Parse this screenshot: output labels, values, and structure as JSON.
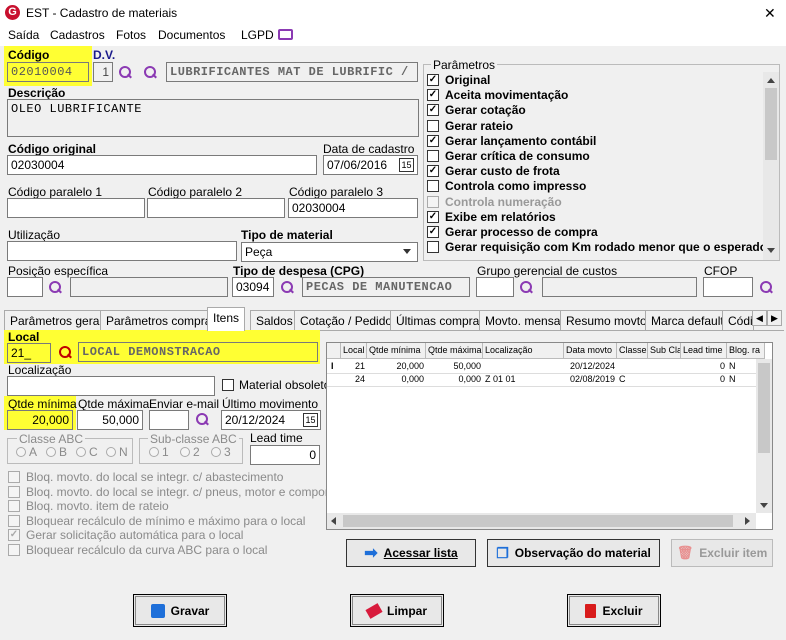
{
  "window": {
    "title": "EST - Cadastro de materiais",
    "close": "✕"
  },
  "menu": [
    "Saída",
    "Cadastros",
    "Fotos",
    "Documentos",
    "LGPD"
  ],
  "header": {
    "codigo_label": "Código",
    "codigo_value": "02010004",
    "dv_label": "D.V.",
    "dv_value": "1",
    "descricao_grupo": "LUBRIFICANTES MAT DE LUBRIFIC / LUBI",
    "descricao_label": "Descrição",
    "descricao_value": "OLEO LUBRIFICANTE",
    "codigo_original_label": "Código original",
    "codigo_original_value": "02030004",
    "data_cadastro_label": "Data de cadastro",
    "data_cadastro_value": "07/06/2016",
    "calendar_label": "15",
    "cod_par1_label": "Código paralelo 1",
    "cod_par2_label": "Código paralelo 2",
    "cod_par3_label": "Código paralelo 3",
    "cod_par3_value": "02030004",
    "utilizacao_label": "Utilização",
    "tipo_material_label": "Tipo de material",
    "tipo_material_value": "Peça",
    "posicao_label": "Posição específica",
    "tipo_despesa_label": "Tipo de despesa (CPG)",
    "tipo_despesa_code": "03094",
    "tipo_despesa_desc": "PECAS DE MANUTENCAO",
    "grupo_gerencial_label": "Grupo gerencial de custos",
    "cfop_label": "CFOP"
  },
  "parametros": {
    "title": "Parâmetros",
    "items": [
      {
        "label": "Original",
        "checked": true,
        "enabled": true
      },
      {
        "label": "Aceita movimentação",
        "checked": true,
        "enabled": true
      },
      {
        "label": "Gerar cotação",
        "checked": true,
        "enabled": true
      },
      {
        "label": "Gerar rateio",
        "checked": false,
        "enabled": true
      },
      {
        "label": "Gerar lançamento contábil",
        "checked": true,
        "enabled": true
      },
      {
        "label": "Gerar crítica de consumo",
        "checked": false,
        "enabled": true
      },
      {
        "label": "Gerar custo de frota",
        "checked": true,
        "enabled": true
      },
      {
        "label": "Controla como impresso",
        "checked": false,
        "enabled": true
      },
      {
        "label": "Controla numeração",
        "checked": false,
        "enabled": false
      },
      {
        "label": "Exibe em relatórios",
        "checked": true,
        "enabled": true
      },
      {
        "label": "Gerar processo de compra",
        "checked": true,
        "enabled": true
      },
      {
        "label": "Gerar requisição com Km rodado menor que o esperado",
        "checked": false,
        "enabled": true
      }
    ]
  },
  "tabs": [
    "Parâmetros gerais",
    "Parâmetros compras",
    "Itens",
    "Saldos",
    "Cotação / Pedido",
    "Últimas compras",
    "Movto. mensal",
    "Resumo movto.",
    "Marca default",
    "Códi"
  ],
  "active_tab": "Itens",
  "itens": {
    "local_label": "Local",
    "local_value": "21_",
    "local_desc": "LOCAL DEMONSTRACAO",
    "localizacao_label": "Localização",
    "obsoleto_label": "Material obsoleto",
    "qtde_min_label": "Qtde mínima",
    "qtde_min_value": "20,000",
    "qtde_max_label": "Qtde máxima",
    "qtde_max_value": "50,000",
    "enviar_label": "Enviar e-mail",
    "ultimo_label": "Último movimento",
    "ultimo_value": "20/12/2024",
    "cal": "15",
    "classe_label": "Classe ABC",
    "classe_opts": [
      "A",
      "B",
      "C",
      "N"
    ],
    "subclasse_label": "Sub-classe ABC",
    "subclasse_opts": [
      "1",
      "2",
      "3"
    ],
    "lead_label": "Lead time",
    "lead_value": "0",
    "checks": [
      {
        "label": "Bloq. movto. do local se integr. c/ abastecimento",
        "checked": false
      },
      {
        "label": "Bloq. movto. do local se integr. c/ pneus, motor e componente",
        "checked": false
      },
      {
        "label": "Bloq. movto. item de rateio",
        "checked": false
      },
      {
        "label": "Bloquear recálculo de mínimo e máximo para o local",
        "checked": false
      },
      {
        "label": "Gerar solicitação automática para o local",
        "checked": true
      },
      {
        "label": "Bloquear recálculo da curva ABC para o local",
        "checked": false
      }
    ]
  },
  "grid": {
    "columns": [
      "Local",
      "Qtde mínima",
      "Qtde máxima",
      "Localização",
      "Data movto",
      "Classe",
      "Sub Cla",
      "Lead time",
      "Blog. ra"
    ],
    "rows": [
      {
        "marker": "I",
        "cells": [
          "21",
          "20,000",
          "50,000",
          "",
          "20/12/2024",
          "",
          "",
          "0",
          "N"
        ]
      },
      {
        "marker": "",
        "cells": [
          "24",
          "0,000",
          "0,000",
          "Z 01 01",
          "02/08/2019",
          "C",
          "",
          "0",
          "N"
        ]
      }
    ]
  },
  "actions": {
    "acessar": "Acessar lista",
    "observacao": "Observação do material",
    "excluir_item": "Excluir item"
  },
  "footer": {
    "gravar": "Gravar",
    "limpar": "Limpar",
    "excluir": "Excluir"
  }
}
